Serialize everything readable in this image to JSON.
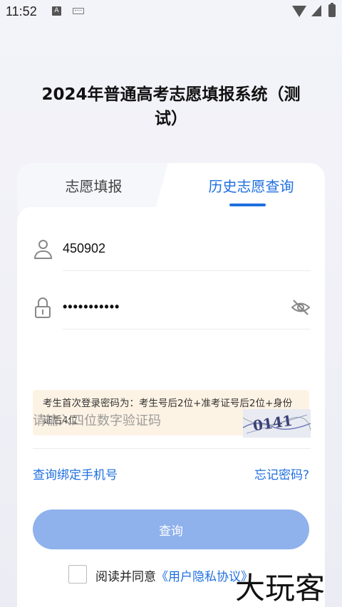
{
  "status_bar": {
    "time": "11:52",
    "a_badge": "A"
  },
  "title": {
    "line1": "2024年普通高考志愿填报系统（测",
    "line2": "试）"
  },
  "tabs": [
    {
      "label": "志愿填报",
      "active": false
    },
    {
      "label": "历史志愿查询",
      "active": true
    }
  ],
  "form": {
    "username": {
      "value": "450902"
    },
    "password": {
      "value": "•••••••••••"
    },
    "notice": "考生首次登录密码为：考生号后2位+准考证号后2位+身份证后4位",
    "captcha": {
      "placeholder": "请输入四位数字验证码",
      "code": "0141"
    },
    "bind_phone_link": "查询绑定手机号",
    "forgot_link": "忘记密码?",
    "submit_label": "查询",
    "agree_text": "阅读并同意",
    "agree_link": "《用户隐私协议》"
  },
  "watermark": "大玩客",
  "colors": {
    "accent": "#1f6fe0",
    "button": "#8fb1ec",
    "notice_bg": "#fdf3e4"
  }
}
